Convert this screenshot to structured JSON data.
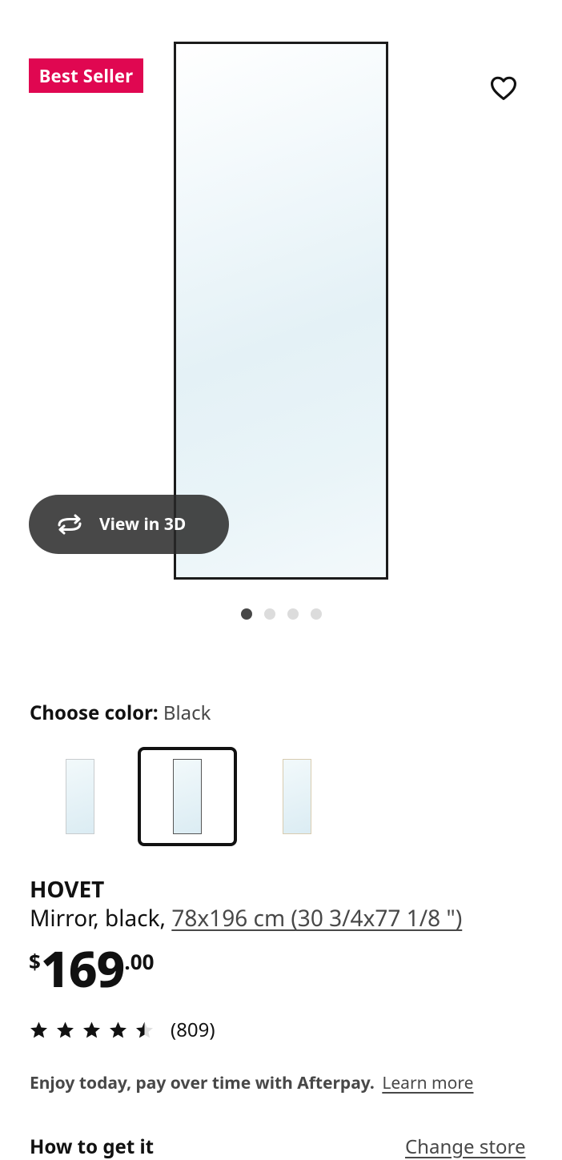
{
  "badge": {
    "label": "Best Seller",
    "color": "#e00751"
  },
  "gallery": {
    "view_3d_label": "View in 3D",
    "favorite_icon": "heart-outline-icon",
    "rotate_icon": "rotate-3d-icon",
    "dots": [
      {
        "active": true
      },
      {
        "active": false
      },
      {
        "active": false
      },
      {
        "active": false
      }
    ]
  },
  "color_chooser": {
    "label": "Choose color:",
    "selected_value": "Black",
    "swatches": [
      {
        "frame": "silver",
        "selected": false
      },
      {
        "frame": "black",
        "selected": true
      },
      {
        "frame": "gold",
        "selected": false
      }
    ]
  },
  "product": {
    "name": "HOVET",
    "description": "Mirror, black, ",
    "size_link": "78x196 cm (30 3/4x77 1/8 \")",
    "price": {
      "currency": "$",
      "integer": "169",
      "decimal": ".00"
    },
    "rating": {
      "stars": 4.5,
      "count": "(809)"
    }
  },
  "afterpay": {
    "message": "Enjoy today, pay over time with Afterpay.",
    "link": "Learn more"
  },
  "fulfillment": {
    "title": "How to get it",
    "change_store": "Change store"
  }
}
